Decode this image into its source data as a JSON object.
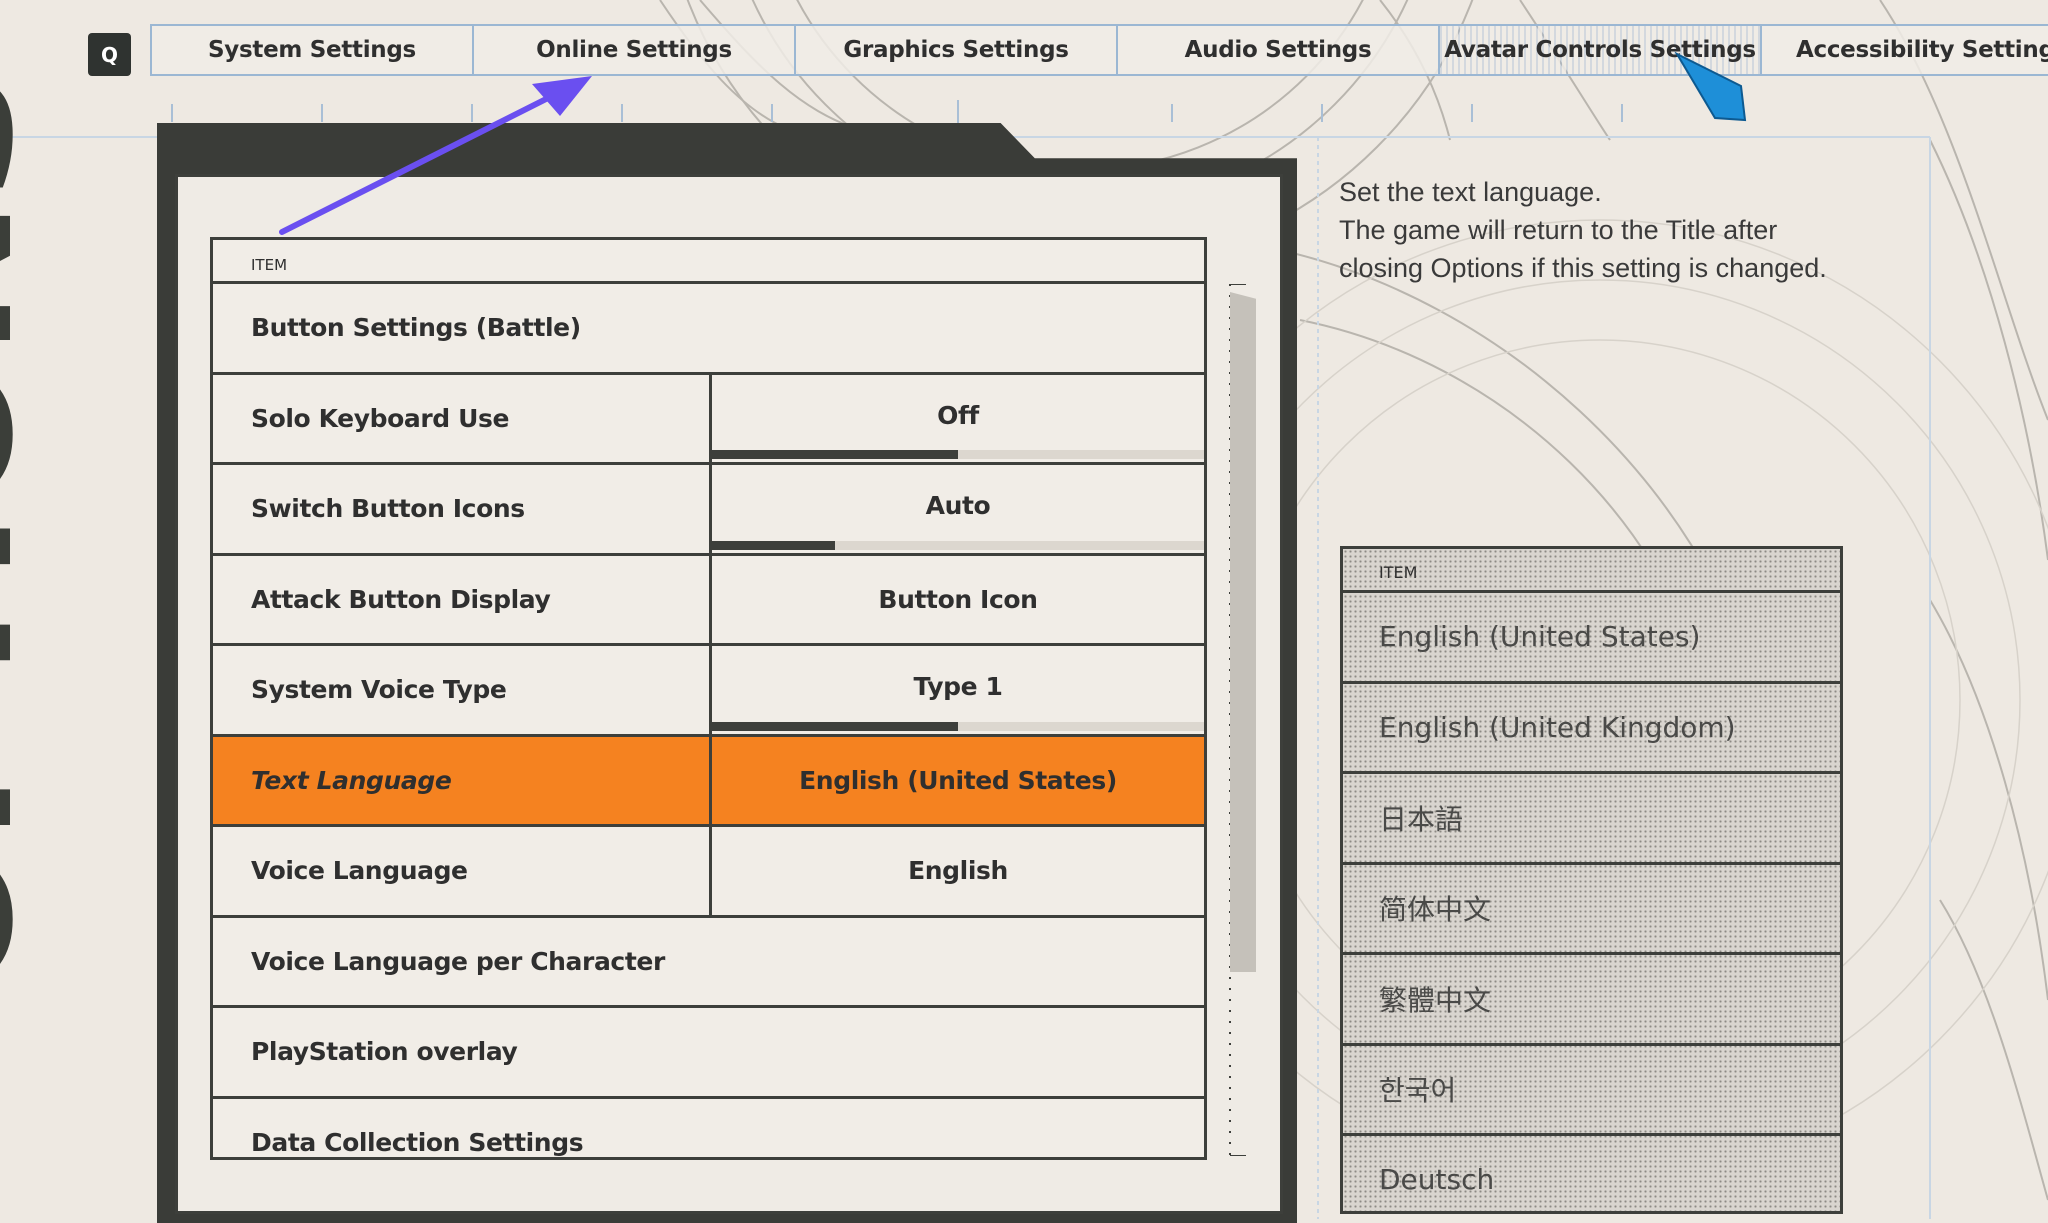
{
  "tabs": {
    "prev_key": "Q",
    "items": [
      {
        "label": "System Settings"
      },
      {
        "label": "Online Settings"
      },
      {
        "label": "Graphics Settings"
      },
      {
        "label": "Audio Settings"
      },
      {
        "label": "Avatar Controls Settings"
      },
      {
        "label": "Accessibility Settings"
      }
    ]
  },
  "page_title": "OPTIONS",
  "settings": {
    "header": "ITEM",
    "rows": [
      {
        "label": "Button Settings (Battle)",
        "value": null
      },
      {
        "label": "Solo Keyboard Use",
        "value": "Off",
        "bar_fraction": 0.5
      },
      {
        "label": "Switch Button Icons",
        "value": "Auto",
        "bar_fraction": 0.25
      },
      {
        "label": "Attack Button Display",
        "value": "Button Icon"
      },
      {
        "label": "System Voice Type",
        "value": "Type 1",
        "bar_fraction": 0.5
      },
      {
        "label": "Text Language",
        "value": "English (United States)",
        "selected": true
      },
      {
        "label": "Voice Language",
        "value": "English"
      },
      {
        "label": "Voice Language per Character",
        "value": null
      },
      {
        "label": "PlayStation overlay",
        "value": null
      },
      {
        "label": "Data Collection Settings",
        "value": null
      }
    ]
  },
  "description": {
    "lines": [
      "Set the text language.",
      "The game will return to the Title after",
      "closing Options if this setting is changed."
    ]
  },
  "language_list": {
    "header": "ITEM",
    "items": [
      "English (United States)",
      "English (United Kingdom)",
      "日本語",
      "简体中文",
      "繁體中文",
      "한국어",
      "Deutsch"
    ]
  },
  "colors": {
    "selected": "#f58220",
    "tab_border": "#9bb7d3",
    "annotation_arrow": "#6a4ff0",
    "cursor": "#1e8fd8"
  }
}
